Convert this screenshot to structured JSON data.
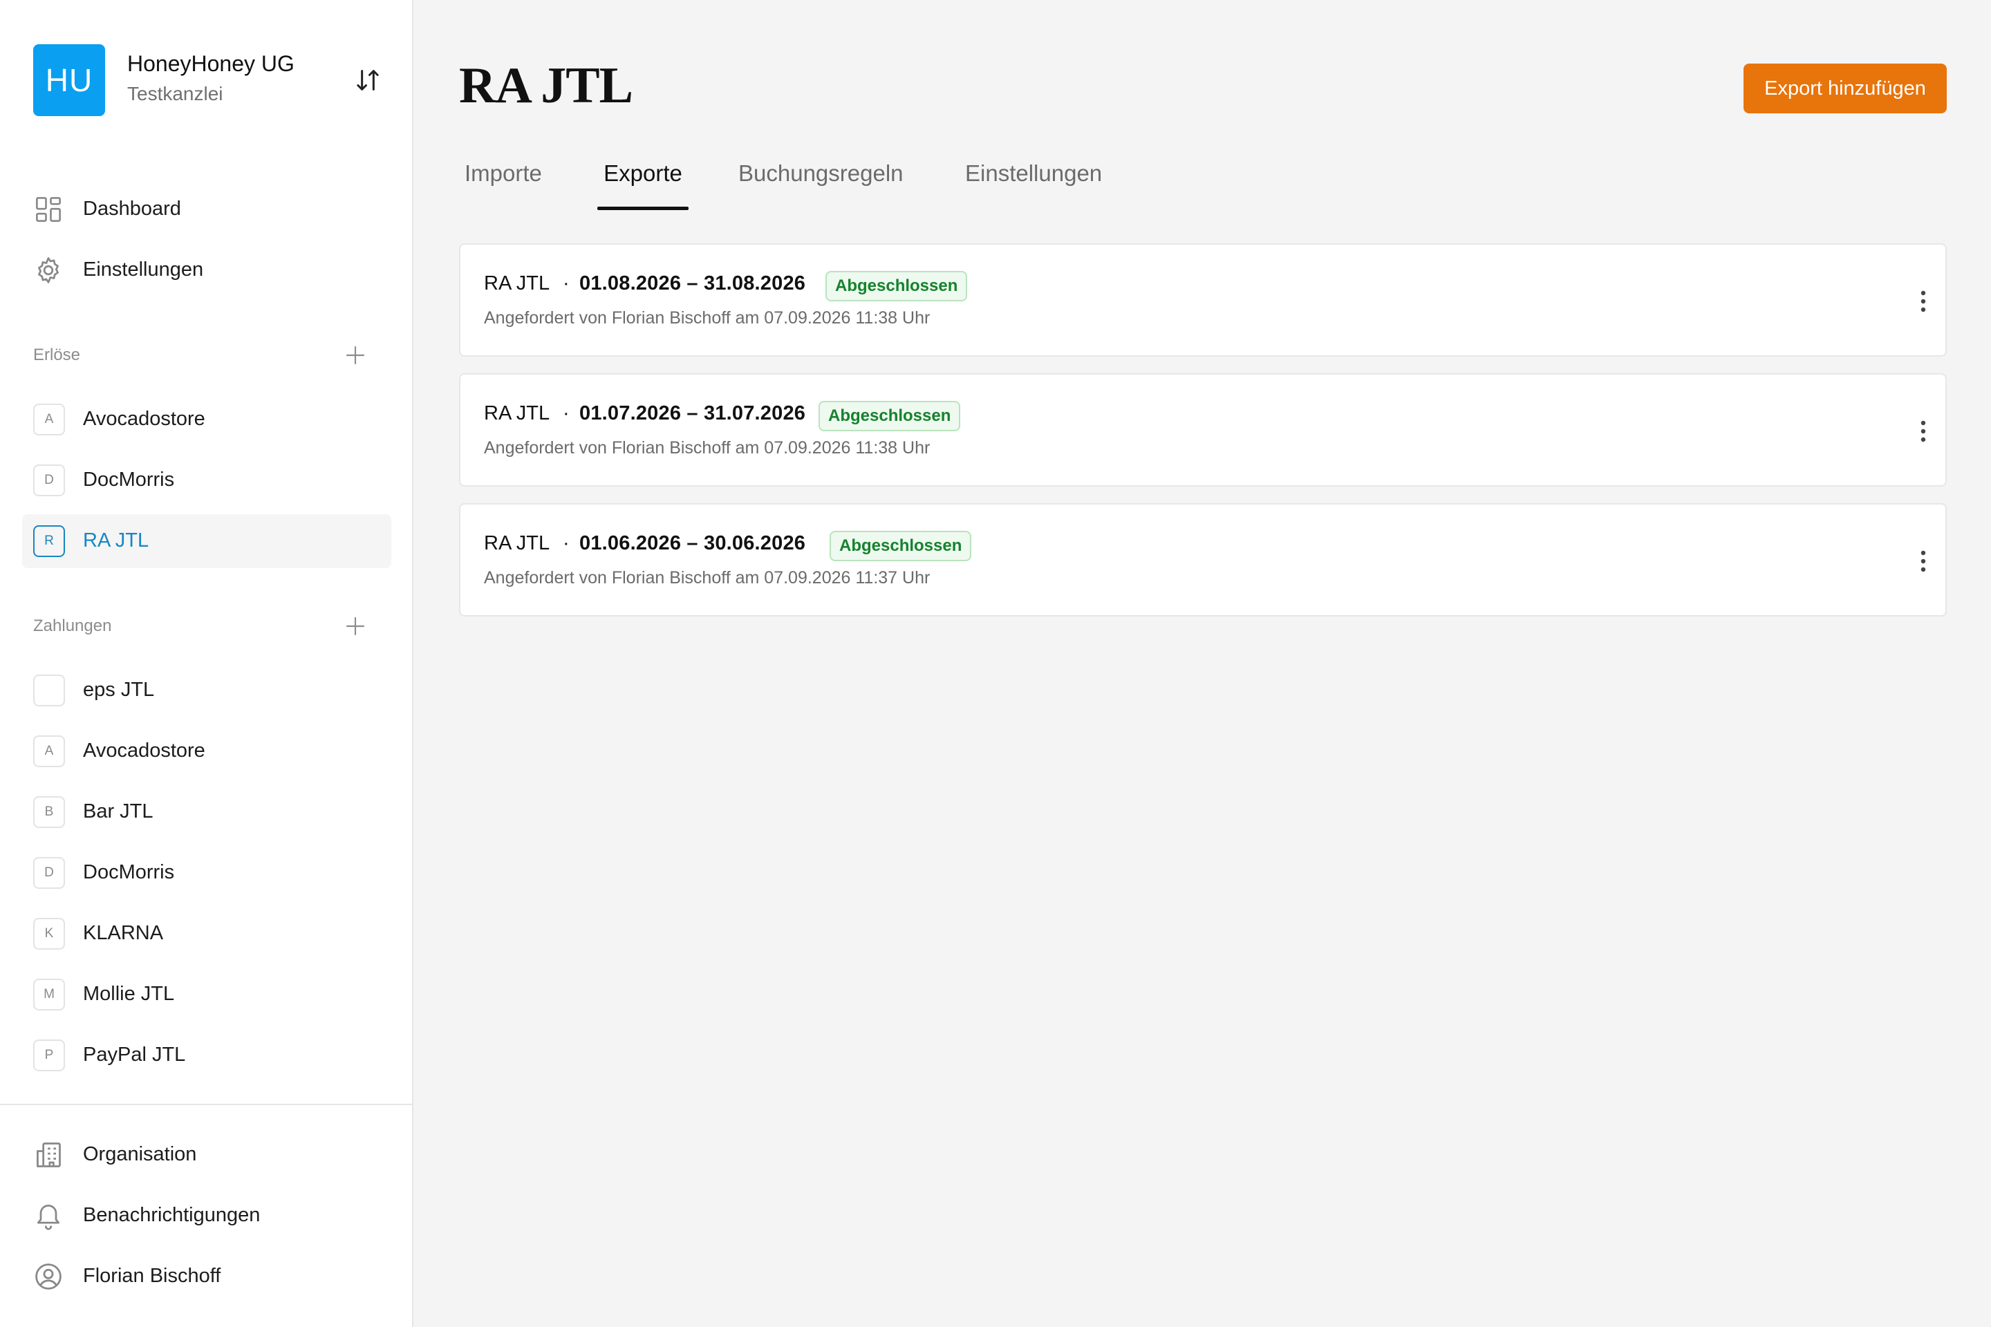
{
  "organization": {
    "initials": "HU",
    "name": "HoneyHoney UG",
    "subtitle": "Testkanzlei",
    "logo_color": "#0a9ff0"
  },
  "sidebar": {
    "top_nav": [
      {
        "label": "Dashboard",
        "icon": "dashboard-grid-icon"
      },
      {
        "label": "Einstellungen",
        "icon": "gear-icon"
      }
    ],
    "revenue_section": {
      "title": "Erlöse",
      "items": [
        {
          "letter": "A",
          "label": "Avocadostore",
          "active": false
        },
        {
          "letter": "D",
          "label": "DocMorris",
          "active": false
        },
        {
          "letter": "R",
          "label": "RA JTL",
          "active": true
        }
      ]
    },
    "payments_section": {
      "title": "Zahlungen",
      "items": [
        {
          "letter": "",
          "label": "eps JTL"
        },
        {
          "letter": "A",
          "label": "Avocadostore"
        },
        {
          "letter": "B",
          "label": "Bar JTL"
        },
        {
          "letter": "D",
          "label": "DocMorris"
        },
        {
          "letter": "K",
          "label": "KLARNA"
        },
        {
          "letter": "M",
          "label": "Mollie JTL"
        },
        {
          "letter": "P",
          "label": "PayPal JTL"
        }
      ]
    },
    "bottom_nav": [
      {
        "label": "Organisation",
        "icon": "building-icon"
      },
      {
        "label": "Benachrichtigungen",
        "icon": "bell-icon"
      },
      {
        "label": "Florian Bischoff",
        "icon": "user-circle-icon"
      }
    ]
  },
  "main": {
    "title": "RA JTL",
    "primary_action": "Export hinzufügen",
    "accent_color": "#e8740c",
    "tabs": [
      {
        "label": "Importe",
        "active": false
      },
      {
        "label": "Exporte",
        "active": true
      },
      {
        "label": "Buchungsregeln",
        "active": false
      },
      {
        "label": "Einstellungen",
        "active": false
      }
    ],
    "exports": [
      {
        "source": "RA JTL",
        "dot": "·",
        "range": "01.08.2026 – 31.08.2026",
        "status": "Abgeschlossen",
        "requested": "Angefordert von Florian Bischoff am 07.09.2026 11:38 Uhr"
      },
      {
        "source": "RA JTL",
        "dot": "·",
        "range": "01.07.2026 – 31.07.2026",
        "status": "Abgeschlossen",
        "requested": "Angefordert von Florian Bischoff am 07.09.2026 11:38 Uhr"
      },
      {
        "source": "RA JTL",
        "dot": "·",
        "range": "01.06.2026 – 30.06.2026",
        "status": "Abgeschlossen",
        "requested": "Angefordert von Florian Bischoff am 07.09.2026 11:37 Uhr"
      }
    ],
    "status_color": "#16822e"
  }
}
